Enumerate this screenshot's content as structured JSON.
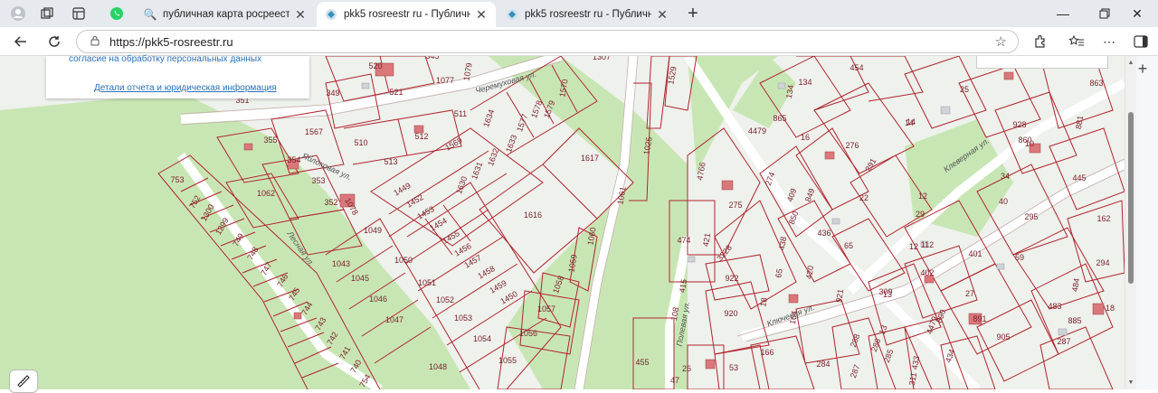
{
  "browser": {
    "tabs": [
      {
        "title": "публичная карта росреестра ирк",
        "favicon": "search-icon",
        "active": false
      },
      {
        "title": "pkk5 rosreestr ru - Публичная ка",
        "favicon": "rosreestr-icon",
        "active": true
      },
      {
        "title": "pkk5 rosreestr ru - Публичная ка",
        "favicon": "rosreestr-icon",
        "active": false
      }
    ],
    "url": "https://pkk5-rosreestr.ru"
  },
  "infopanel": {
    "consent_text": "согласие на обработку персональных данных",
    "details_link": "Детали отчета и юридическая информация"
  },
  "map": {
    "streets": [
      "Черемуховая ул.",
      "Яблоковая ул.",
      "Лесная ул.",
      "Ключевая ул.",
      "Полевая ул.",
      "Клеверная ул."
    ],
    "parcels": [
      "520",
      "521",
      "349",
      "351",
      "345",
      "1079",
      "1077",
      "1307",
      "1570",
      "1529",
      "454",
      "134",
      "134",
      "863",
      "881",
      "1579",
      "1578",
      "1577",
      "1634",
      "511",
      "512",
      "510",
      "355",
      "354",
      "353",
      "352",
      "1078",
      "513",
      "1567",
      "1633",
      "1632",
      "1631",
      "1630",
      "1569",
      "1449",
      "1452",
      "1453",
      "1454",
      "1455",
      "1456",
      "1457",
      "1458",
      "1459",
      "1450",
      "1617",
      "1616",
      "1025",
      "1061",
      "1060",
      "1059",
      "1058",
      "1057",
      "1056",
      "1055",
      "1054",
      "1053",
      "1052",
      "1051",
      "1050",
      "1049",
      "1048",
      "1047",
      "1046",
      "1045",
      "1043",
      "1062",
      "753",
      "752",
      "1300",
      "1299",
      "749",
      "748",
      "747",
      "746",
      "745",
      "744",
      "743",
      "742",
      "741",
      "740",
      "754",
      "865",
      "16",
      "4479",
      "276",
      "291",
      "14",
      "25",
      "928",
      "860",
      "10",
      "445",
      "274",
      "409",
      "275",
      "849",
      "850",
      "436",
      "65",
      "438",
      "65",
      "420",
      "921",
      "922",
      "920",
      "3228",
      "474",
      "4766",
      "421",
      "415",
      "108",
      "18",
      "164",
      "166",
      "53",
      "26",
      "47",
      "455",
      "284",
      "288",
      "287",
      "286",
      "285",
      "13",
      "309",
      "311",
      "433",
      "434",
      "4479",
      "890",
      "891",
      "905",
      "27",
      "112",
      "402",
      "401",
      "29",
      "34",
      "40",
      "295",
      "162",
      "59",
      "294",
      "484",
      "483",
      "885",
      "18",
      "287",
      "12",
      "12",
      "13",
      "22",
      "14"
    ]
  }
}
